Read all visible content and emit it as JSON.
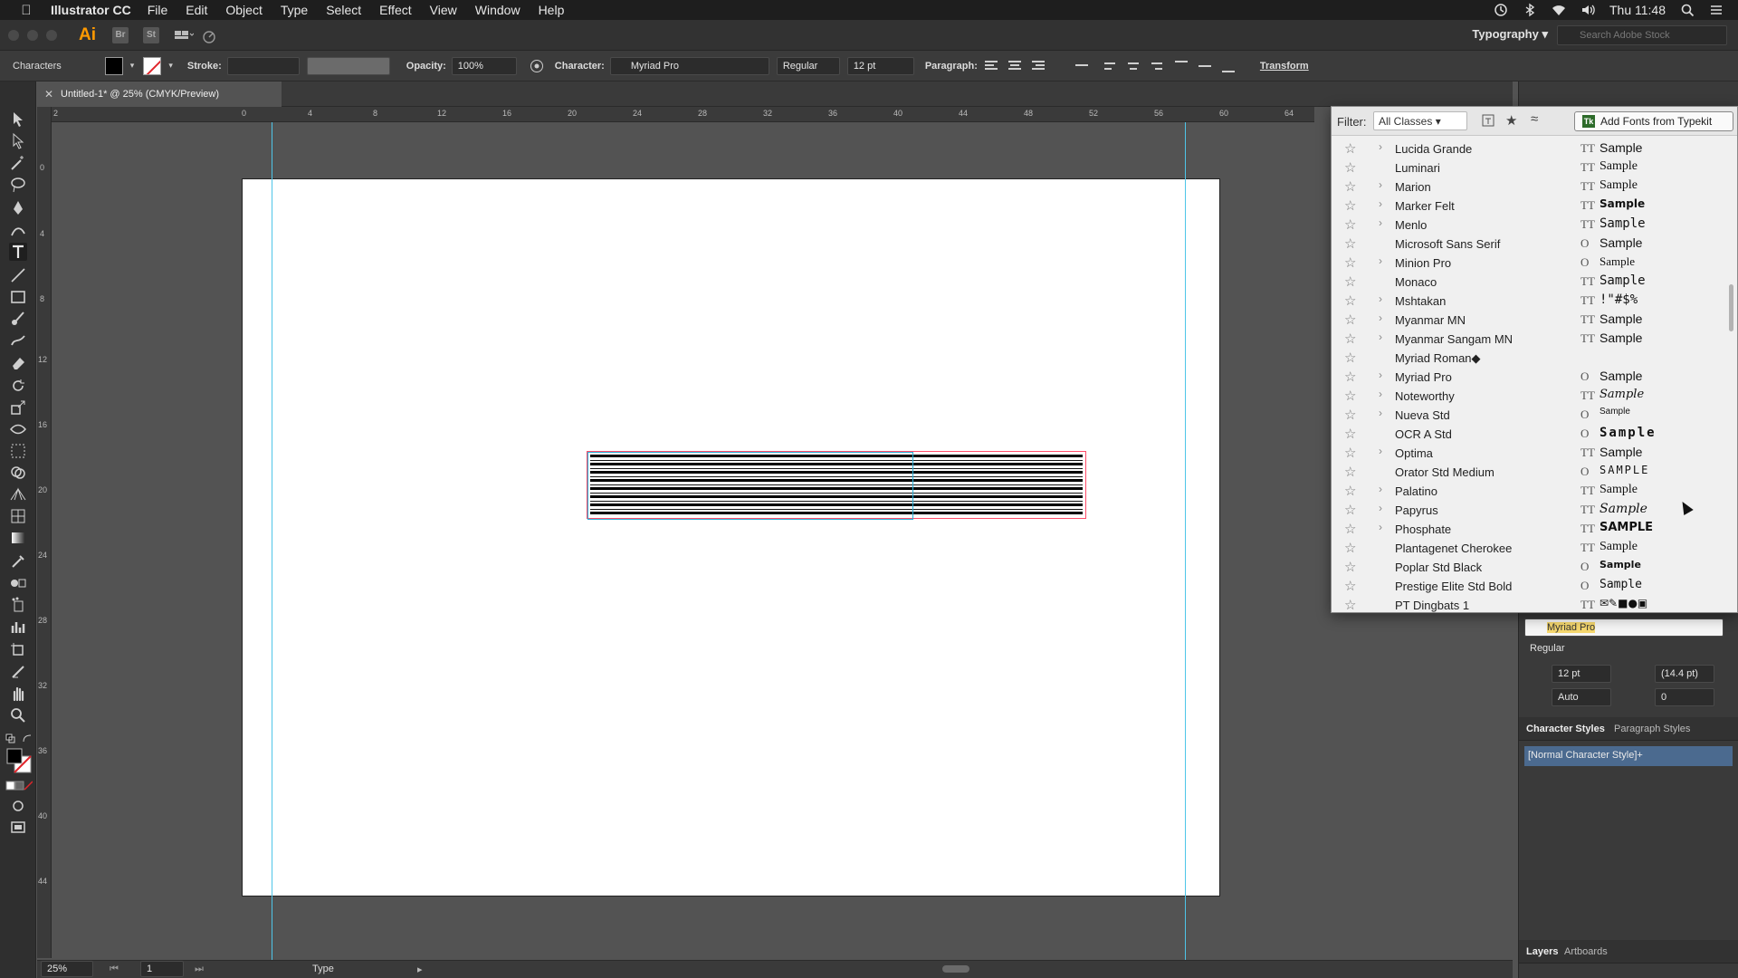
{
  "menubar": {
    "app_name": "Illustrator CC",
    "menus": [
      "File",
      "Edit",
      "Object",
      "Type",
      "Select",
      "Effect",
      "View",
      "Window",
      "Help"
    ],
    "clock": "Thu 11:48"
  },
  "appbar": {
    "logo": "Ai",
    "bridge": "Br",
    "stock": "St",
    "workspace": "Typography",
    "stock_search_placeholder": "Search Adobe Stock"
  },
  "controlbar": {
    "selection_label": "Characters",
    "stroke_label": "Stroke:",
    "opacity_label": "Opacity:",
    "opacity_value": "100%",
    "character_label": "Character:",
    "font_family": "Myriad Pro",
    "font_style": "Regular",
    "font_size": "12 pt",
    "paragraph_label": "Paragraph:",
    "transform_label": "Transform"
  },
  "document": {
    "tab_title": "Untitled-1* @ 25% (CMYK/Preview)",
    "ruler_top": [
      "2",
      "0",
      "4",
      "8",
      "12",
      "16",
      "20",
      "24",
      "28",
      "32",
      "36",
      "40",
      "44",
      "48",
      "52",
      "56",
      "60",
      "64"
    ],
    "ruler_left": [
      "0",
      "4",
      "8",
      "12",
      "16",
      "20",
      "24",
      "28",
      "32",
      "36",
      "40",
      "44"
    ]
  },
  "statusbar": {
    "zoom": "25%",
    "artboard_number": "1",
    "tool": "Type"
  },
  "fontmenu": {
    "filter_label": "Filter:",
    "filter_value": "All Classes",
    "add_fonts_label": "Add Fonts from Typekit",
    "fonts": [
      {
        "name": "Lucida Grande",
        "expand": true,
        "type": "TT",
        "sample": "Sample"
      },
      {
        "name": "Luminari",
        "expand": false,
        "type": "TT",
        "sample": "Sample"
      },
      {
        "name": "Marion",
        "expand": true,
        "type": "TT",
        "sample": "Sample"
      },
      {
        "name": "Marker Felt",
        "expand": true,
        "type": "TT",
        "sample": "Sample"
      },
      {
        "name": "Menlo",
        "expand": true,
        "type": "TT",
        "sample": "Sample"
      },
      {
        "name": "Microsoft Sans Serif",
        "expand": false,
        "type": "O",
        "sample": "Sample"
      },
      {
        "name": "Minion Pro",
        "expand": true,
        "type": "O",
        "sample": "Sample"
      },
      {
        "name": "Monaco",
        "expand": false,
        "type": "TT",
        "sample": "Sample"
      },
      {
        "name": "Mshtakan",
        "expand": true,
        "type": "TT",
        "sample": "!\"#$%"
      },
      {
        "name": "Myanmar MN",
        "expand": true,
        "type": "TT",
        "sample": "Sample"
      },
      {
        "name": "Myanmar Sangam MN",
        "expand": true,
        "type": "TT",
        "sample": "Sample"
      },
      {
        "name": "Myriad Roman◆",
        "expand": false,
        "type": "",
        "sample": ""
      },
      {
        "name": "Myriad Pro",
        "expand": true,
        "type": "O",
        "sample": "Sample"
      },
      {
        "name": "Noteworthy",
        "expand": true,
        "type": "TT",
        "sample": "Sample"
      },
      {
        "name": "Nueva Std",
        "expand": true,
        "type": "O",
        "sample": "Sample"
      },
      {
        "name": "OCR A Std",
        "expand": false,
        "type": "O",
        "sample": "Sample"
      },
      {
        "name": "Optima",
        "expand": true,
        "type": "TT",
        "sample": "Sample"
      },
      {
        "name": "Orator Std Medium",
        "expand": false,
        "type": "O",
        "sample": "SAMPLE"
      },
      {
        "name": "Palatino",
        "expand": true,
        "type": "TT",
        "sample": "Sample"
      },
      {
        "name": "Papyrus",
        "expand": true,
        "type": "TT",
        "sample": "Sample"
      },
      {
        "name": "Phosphate",
        "expand": true,
        "type": "TT",
        "sample": "SAMPLE"
      },
      {
        "name": "Plantagenet Cherokee",
        "expand": false,
        "type": "TT",
        "sample": "Sample"
      },
      {
        "name": "Poplar Std Black",
        "expand": false,
        "type": "O",
        "sample": "Sample"
      },
      {
        "name": "Prestige Elite Std Bold",
        "expand": false,
        "type": "O",
        "sample": "Sample"
      },
      {
        "name": "PT Dingbats 1",
        "expand": false,
        "type": "TT",
        "sample": "✉✎■●▣"
      }
    ]
  },
  "character_panel": {
    "font_search": "Myriad Pro",
    "font_style": "Regular",
    "size": "12 pt",
    "leading": "(14.4 pt)",
    "kerning": "Auto",
    "tracking": "0"
  },
  "styles_panel": {
    "tab_char": "Character Styles",
    "tab_para": "Paragraph Styles",
    "selected_style": "[Normal Character Style]+"
  },
  "layers_panel": {
    "tab_layers": "Layers",
    "tab_artboards": "Artboards"
  },
  "colors": {
    "menubar_bg": "#1e1e1e",
    "canvas_bg": "#535353",
    "guide": "#4ec5e8",
    "selection_red": "#ff4d6a",
    "ai_orange": "#ff9a00"
  }
}
